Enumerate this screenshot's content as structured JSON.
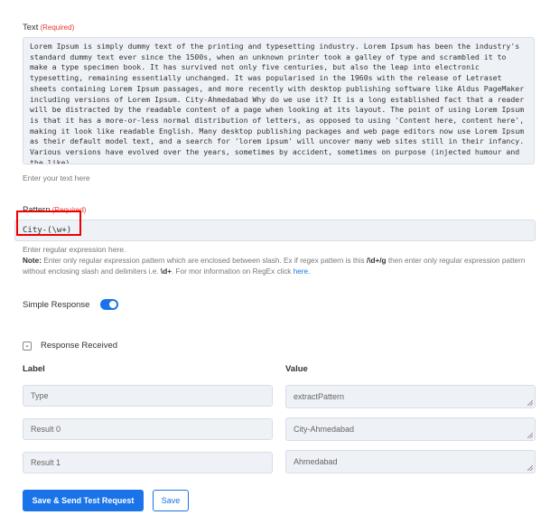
{
  "text_field": {
    "label": "Text",
    "required": "(Required)",
    "value": "Lorem Ipsum is simply dummy text of the printing and typesetting industry. Lorem Ipsum has been the industry's standard dummy text ever since the 1500s, when an unknown printer took a galley of type and scrambled it to make a type specimen book. It has survived not only five centuries, but also the leap into electronic typesetting, remaining essentially unchanged. It was popularised in the 1960s with the release of Letraset sheets containing Lorem Ipsum passages, and more recently with desktop publishing software like Aldus PageMaker including versions of Lorem Ipsum. City-Ahmedabad Why do we use it? It is a long established fact that a reader will be distracted by the readable content of a page when looking at its layout. The point of using Lorem Ipsum is that it has a more-or-less normal distribution of letters, as opposed to using 'Content here, content here', making it look like readable English. Many desktop publishing packages and web page editors now use Lorem Ipsum as their default model text, and a search for 'lorem ipsum' will uncover many web sites still in their infancy. Various versions have evolved over the years, sometimes by accident, sometimes on purpose (injected humour and the like)",
    "help": "Enter your text here"
  },
  "pattern_field": {
    "label": "Pattern",
    "required": "(Required)",
    "value": "City-(\\w+)",
    "help": "Enter regular expression here.",
    "note_label": "Note:",
    "note_text_1": "Enter only regular expression pattern which are enclosed between slash. Ex if regex pattern is this",
    "note_example_1": "/\\d+/g",
    "note_text_2": "then enter only regular expression pattern without enclosing slash and delimiters i.e.",
    "note_example_2": "\\d+",
    "note_text_3": ". For mor information on RegEx click",
    "note_link": "here."
  },
  "simple_response": {
    "label": "Simple Response",
    "enabled": true
  },
  "response_received": {
    "label": "Response Received",
    "col_label": "Label",
    "col_value": "Value",
    "rows": [
      {
        "label": "Type",
        "value": "extractPattern"
      },
      {
        "label": "Result 0",
        "value": "City-Ahmedabad"
      },
      {
        "label": "Result 1",
        "value": "Ahmedabad"
      }
    ]
  },
  "buttons": {
    "save_send": "Save & Send Test Request",
    "save": "Save"
  },
  "colors": {
    "accent": "#1a73e8",
    "required": "#e53935",
    "field_bg": "#eef1f6",
    "highlight": "#e00000"
  }
}
